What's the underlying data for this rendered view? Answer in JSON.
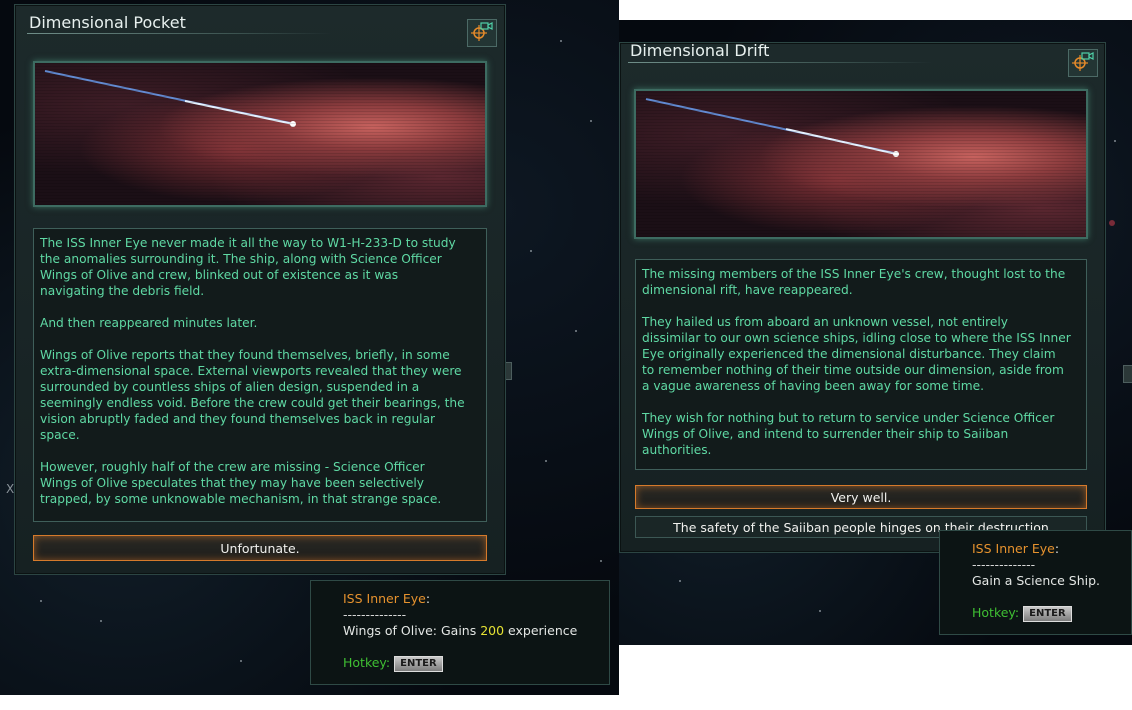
{
  "left": {
    "title": "Dimensional Pocket",
    "camera_icon": "locate-camera-icon",
    "paragraphs": [
      "The ISS Inner Eye never made it all the way to W1-H-233-D to study\nthe anomalies surrounding it. The ship, along with Science Officer\nWings of Olive and crew, blinked out of existence as it was\nnavigating the debris field.",
      "And then reappeared minutes later.",
      "Wings of Olive reports that they found themselves, briefly, in some\nextra-dimensional space. External viewports revealed that they were\nsurrounded by countless ships of alien design, suspended in a\nseemingly endless void. Before the crew could get their bearings, the\nvision abruptly faded and they found themselves back in regular\nspace.",
      "However, roughly half of the crew are missing - Science Officer\nWings of Olive speculates that they may have been selectively\ntrapped, by some unknowable mechanism, in that strange space."
    ],
    "option": "Unfortunate.",
    "tooltip": {
      "ship": "ISS Inner Eye",
      "colon": ":",
      "separator": "--------------",
      "effect_prefix": "Wings of Olive: Gains ",
      "effect_value": "200",
      "effect_suffix": " experience",
      "hotkey_label": "Hotkey:",
      "hotkey_key": "ENTER"
    },
    "stray_label": "XX"
  },
  "right": {
    "title": "Dimensional Drift",
    "camera_icon": "locate-camera-icon",
    "paragraphs": [
      "The missing members of the ISS Inner Eye's crew, thought lost to the\ndimensional rift, have reappeared.",
      "They hailed us from aboard an unknown vessel, not entirely\ndissimilar to our own science ships, idling close to where the ISS Inner\nEye originally experienced the dimensional disturbance. They claim\nto remember nothing of their time outside our dimension, aside from\na vague awareness of having been away for some time.",
      "They wish for nothing but to return to service under Science Officer\nWings of Olive, and intend to surrender their ship to Saiiban\nauthorities."
    ],
    "option_primary": "Very well.",
    "option_secondary": "The safety of the Saiiban people hinges on their destruction",
    "tooltip": {
      "ship": "ISS Inner Eye",
      "colon": ":",
      "separator": "--------------",
      "effect": "Gain a Science Ship.",
      "hotkey_label": "Hotkey:",
      "hotkey_key": "ENTER"
    }
  },
  "colors": {
    "body_text": "#5fd9a4",
    "ship_name": "#e6922e",
    "hotkey": "#3fbf33",
    "value_highlight": "#e5e234",
    "option_border": "#d57a2b"
  }
}
